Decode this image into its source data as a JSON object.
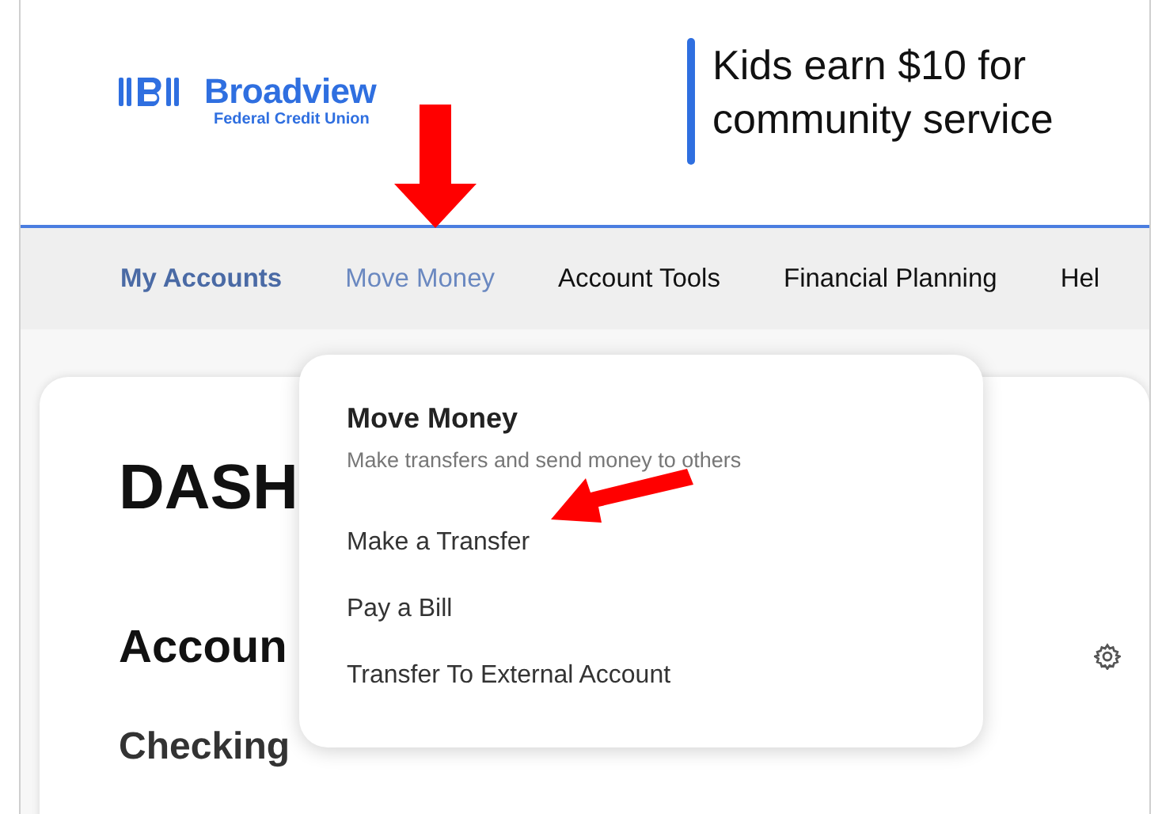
{
  "header": {
    "logo": {
      "name": "Broadview",
      "subtitle": "Federal Credit Union"
    },
    "promo": "Kids earn $10 for community service"
  },
  "nav": [
    {
      "label": "My Accounts",
      "selected": false,
      "kind": "bold"
    },
    {
      "label": "Move Money",
      "selected": true,
      "kind": "plain"
    },
    {
      "label": "Account Tools",
      "selected": false,
      "kind": "plain"
    },
    {
      "label": "Financial Planning",
      "selected": false,
      "kind": "plain"
    },
    {
      "label": "Hel",
      "selected": false,
      "kind": "plain"
    }
  ],
  "dashboard": {
    "title": "DASH",
    "section": "Accoun",
    "subsection": "Checking"
  },
  "dropdown": {
    "title": "Move Money",
    "subtitle": "Make transfers and send money to others",
    "items": [
      "Make a Transfer",
      "Pay a Bill",
      "Transfer To External Account"
    ]
  }
}
